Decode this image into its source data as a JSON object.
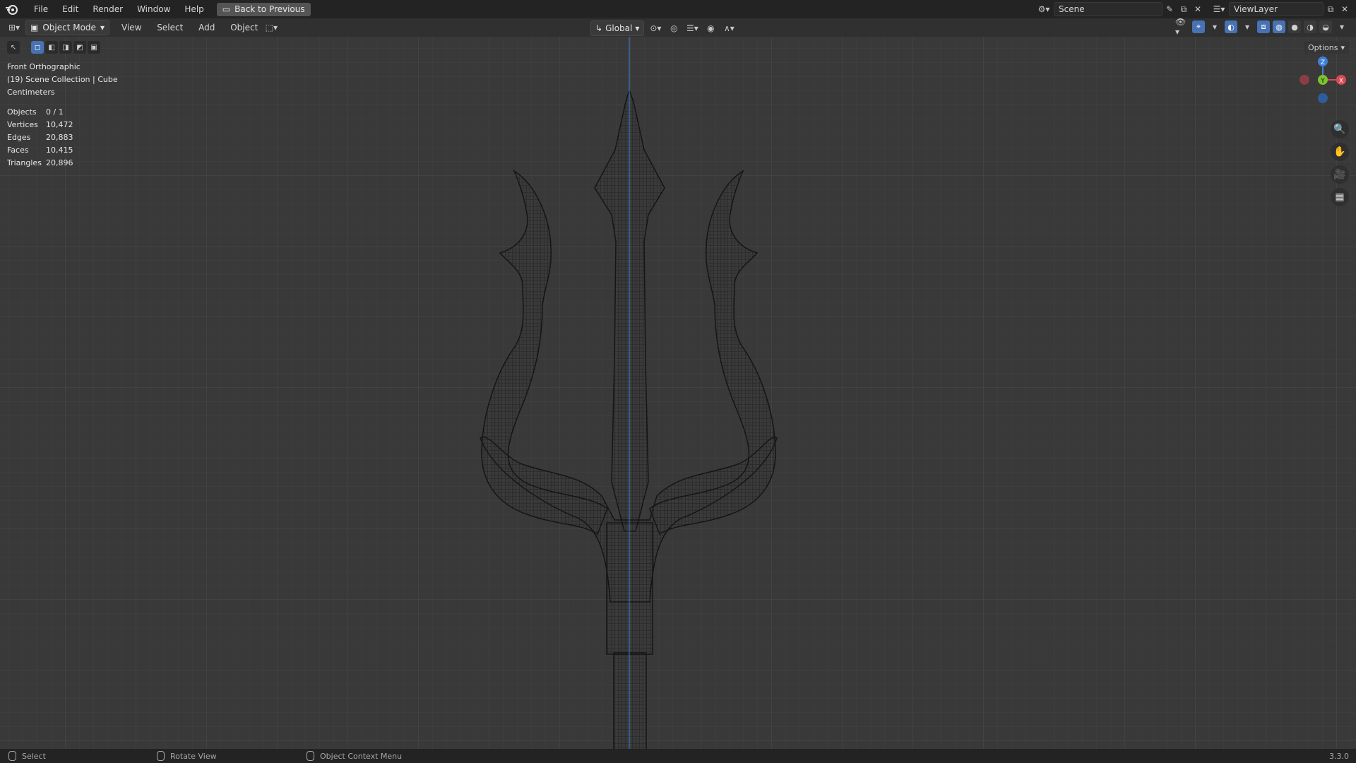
{
  "app": {
    "menus": [
      "File",
      "Edit",
      "Render",
      "Window",
      "Help"
    ],
    "back_button": "Back to Previous",
    "scene_name": "Scene",
    "view_layer": "ViewLayer",
    "version": "3.3.0"
  },
  "header": {
    "mode": "Object Mode",
    "menus": [
      "View",
      "Select",
      "Add",
      "Object"
    ],
    "transform_orientation": "Global",
    "options_label": "Options"
  },
  "viewport": {
    "view_name": "Front Orthographic",
    "collection": "(19) Scene Collection | Cube",
    "units": "Centimeters",
    "stats": [
      {
        "label": "Objects",
        "value": "0 / 1"
      },
      {
        "label": "Vertices",
        "value": "10,472"
      },
      {
        "label": "Edges",
        "value": "20,883"
      },
      {
        "label": "Faces",
        "value": "10,415"
      },
      {
        "label": "Triangles",
        "value": "20,896"
      }
    ],
    "gizmo_axes": [
      "Z",
      "Y",
      "X"
    ]
  },
  "statusbar": {
    "select": "Select",
    "rotate": "Rotate View",
    "context": "Object Context Menu"
  },
  "colors": {
    "accent": "#4772b3",
    "axis_x": "#d94a55",
    "axis_y": "#7cc22c",
    "axis_z": "#3f7fd6",
    "viewport_bg": "#393939"
  }
}
